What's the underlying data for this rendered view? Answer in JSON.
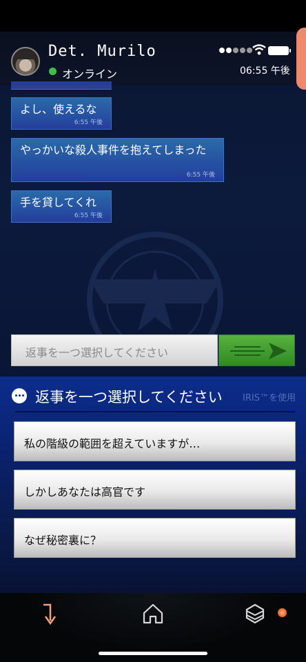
{
  "header": {
    "contact_name": "Det. Murilo",
    "status": "オンライン",
    "time": "06:55 午後"
  },
  "messages": [
    {
      "text": "よし、使えるな",
      "time": "6:55 午後"
    },
    {
      "text": "やっかいな殺人事件を抱えてしまった",
      "time": "6:55 午後"
    },
    {
      "text": "手を貸してくれ",
      "time": "6:55 午後"
    }
  ],
  "reply": {
    "placeholder": "返事を一つ選択してください"
  },
  "choice_panel": {
    "title": "返事を一つ選択してください",
    "iris_note": "IRIS™を使用",
    "options": [
      "私の階級の範囲を超えていますが…",
      "しかしあなたは高官です",
      "なぜ秘密裏に？"
    ]
  },
  "icons": {
    "nav_back": "arrow-turn-down-icon",
    "nav_home": "home-icon",
    "nav_menu": "cube-menu-icon",
    "send": "send-arrow-icon"
  },
  "colors": {
    "bubble": "#2a4fa6",
    "send_button": "#3f9a2e",
    "online": "#3fbf48",
    "accent_orange": "#ef8a6c"
  }
}
